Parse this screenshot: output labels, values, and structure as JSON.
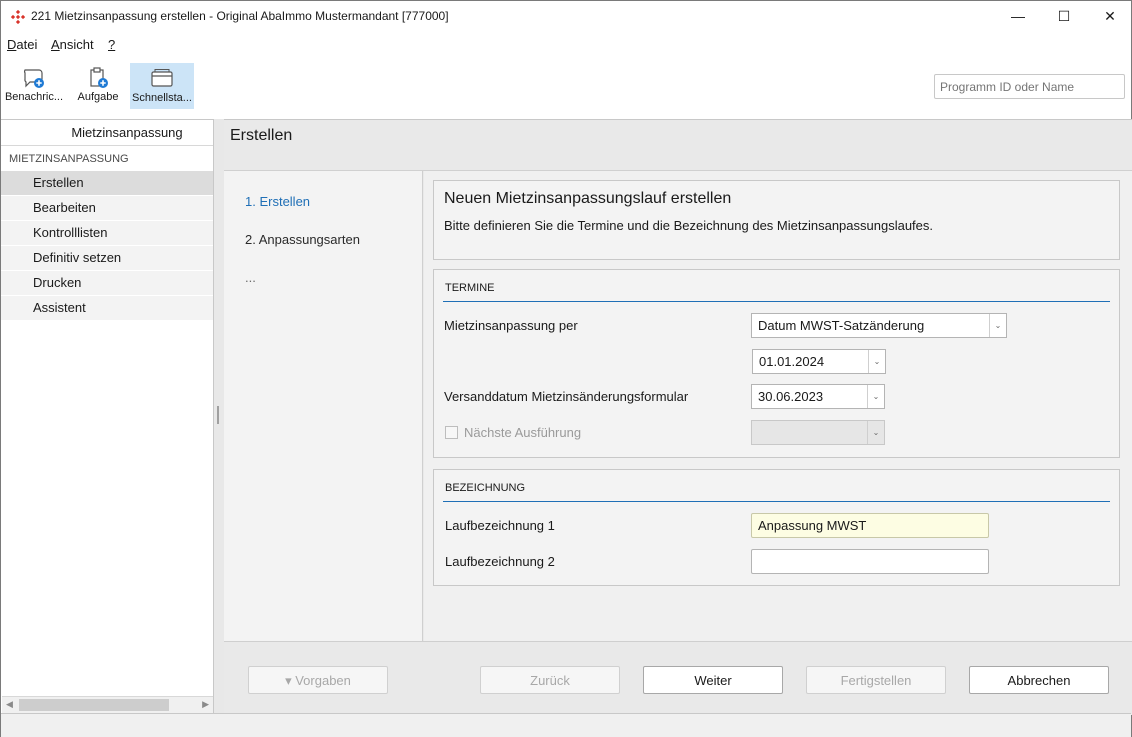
{
  "window": {
    "title": "221 Mietzinsanpassung erstellen - Original AbaImmo Mustermandant [777000]",
    "min_glyph": "—",
    "max_glyph": "☐",
    "close_glyph": "✕"
  },
  "menu": {
    "datei_u": "D",
    "datei_rest": "atei",
    "ansicht_u": "A",
    "ansicht_rest": "nsicht",
    "help_u": "?"
  },
  "toolbar": {
    "buttons": [
      {
        "label": "Benachric...",
        "icon": "chat-bubble-add-icon"
      },
      {
        "label": "Aufgabe",
        "icon": "clipboard-add-icon"
      },
      {
        "label": "Schnellsta...",
        "icon": "window-icon"
      }
    ],
    "search_placeholder": "Programm ID oder Name"
  },
  "left_nav": {
    "header": "Mietzinsanpassung",
    "section": "MIETZINSANPASSUNG",
    "items": [
      "Erstellen",
      "Bearbeiten",
      "Kontrolllisten",
      "Definitiv setzen",
      "Drucken",
      "Assistent"
    ],
    "selected_index": 0
  },
  "main": {
    "title": "Erstellen",
    "steps": [
      "1. Erstellen",
      "2. Anpassungsarten",
      "..."
    ],
    "active_step": 0,
    "intro": {
      "title": "Neuen Mietzinsanpassungslauf erstellen",
      "subtitle": "Bitte definieren Sie die Termine und die Bezeichnung des Mietzinsanpassungslaufes."
    },
    "termine": {
      "heading": "TERMINE",
      "per_label": "Mietzinsanpassung per",
      "per_value": "Datum MWST-Satzänderung",
      "date_value": "01.01.2024",
      "versand_label": "Versanddatum Mietzinsänderungsformular",
      "versand_value": "30.06.2023",
      "next_label": "Nächste Ausführung",
      "next_checked": false,
      "next_value": ""
    },
    "bezeichnung": {
      "heading": "BEZEICHNUNG",
      "lauf1_label": "Laufbezeichnung 1",
      "lauf1_value": "Anpassung MWST",
      "lauf2_label": "Laufbezeichnung 2",
      "lauf2_value": ""
    },
    "buttons": {
      "vorgaben": "▾ Vorgaben",
      "zurueck": "Zurück",
      "weiter": "Weiter",
      "fertigstellen": "Fertigstellen",
      "abbrechen": "Abbrechen"
    }
  },
  "colors": {
    "accent": "#1f6fb6",
    "active_toolbar": "#cce4f7",
    "highlight_field": "#fdfde3",
    "app_icon": "#d9342b"
  }
}
